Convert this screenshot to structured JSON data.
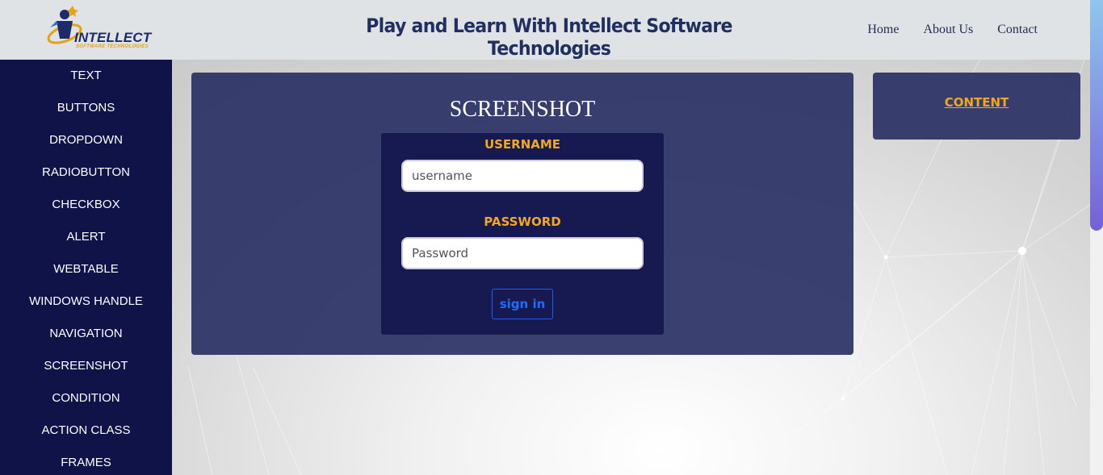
{
  "header": {
    "logo_text": "INTELLECT",
    "logo_subtext": "SOFTWARE TECHNOLOGIES",
    "title": "Play and Learn With Intellect Software Technologies",
    "nav": [
      "Home",
      "About Us",
      "Contact"
    ]
  },
  "sidebar": {
    "items": [
      "TEXT",
      "BUTTONS",
      "DROPDOWN",
      "RADIOBUTTON",
      "CHECKBOX",
      "ALERT",
      "WEBTABLE",
      "WINDOWS HANDLE",
      "NAVIGATION",
      "SCREENSHOT",
      "CONDITION",
      "ACTION CLASS",
      "FRAMES"
    ]
  },
  "main": {
    "title": "SCREENSHOT",
    "username_label": "USERNAME",
    "username_placeholder": "username",
    "password_label": "PASSWORD",
    "password_placeholder": "Password",
    "signin_label": "sign in"
  },
  "side_card": {
    "link_label": "CONTENT"
  },
  "colors": {
    "sidebar_bg": "#0f1348",
    "header_bg": "#e0e3e5",
    "card_bg": "#262c62",
    "accent": "#f2a81d",
    "button": "#1e6bff"
  }
}
